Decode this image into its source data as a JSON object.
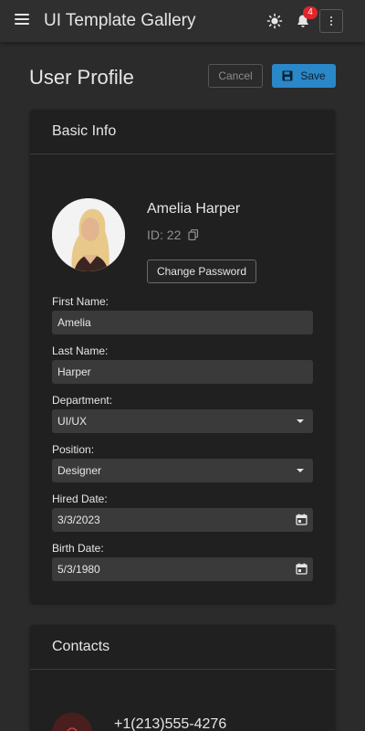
{
  "app": {
    "title": "UI Template Gallery",
    "notification_count": "4"
  },
  "page": {
    "title": "User Profile",
    "cancel_label": "Cancel",
    "save_label": "Save"
  },
  "basic_info": {
    "header": "Basic Info",
    "name": "Amelia Harper",
    "id_text": "ID: 22",
    "change_password_label": "Change Password",
    "fields": {
      "first_name": {
        "label": "First Name:",
        "value": "Amelia"
      },
      "last_name": {
        "label": "Last Name:",
        "value": "Harper"
      },
      "department": {
        "label": "Department:",
        "value": "UI/UX"
      },
      "position": {
        "label": "Position:",
        "value": "Designer"
      },
      "hired_date": {
        "label": "Hired Date:",
        "value": "3/3/2023"
      },
      "birth_date": {
        "label": "Birth Date:",
        "value": "5/3/1980"
      }
    }
  },
  "contacts": {
    "header": "Contacts",
    "phone": "+1(213)555-4276"
  },
  "icons": {
    "menu": "hamburger-icon",
    "theme": "sun-icon",
    "notifications": "bell-icon",
    "more": "more-vertical-icon",
    "save": "floppy-disk-icon",
    "copy": "copy-icon",
    "calendar": "calendar-icon",
    "dropdown": "chevron-down-icon"
  },
  "colors": {
    "accent": "#2a87c8",
    "badge": "#e0262c",
    "background": "#2b2b2b",
    "card": "#202020"
  }
}
